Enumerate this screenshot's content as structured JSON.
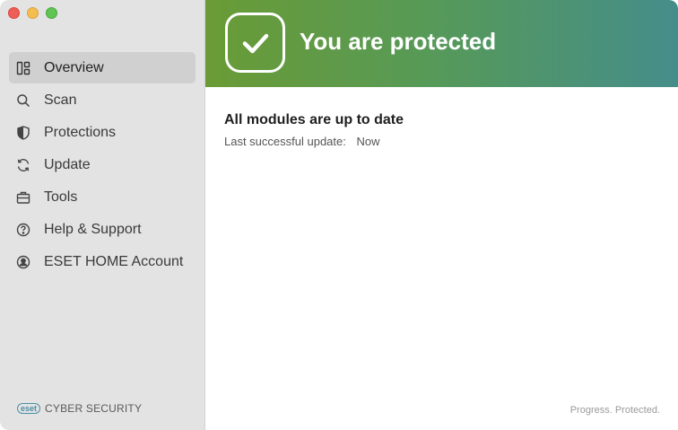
{
  "window": {
    "traffic_lights": [
      "close",
      "minimize",
      "maximize"
    ]
  },
  "sidebar": {
    "items": [
      {
        "label": "Overview",
        "icon": "dashboard-icon",
        "active": true
      },
      {
        "label": "Scan",
        "icon": "search-icon"
      },
      {
        "label": "Protections",
        "icon": "shield-icon"
      },
      {
        "label": "Update",
        "icon": "refresh-icon"
      },
      {
        "label": "Tools",
        "icon": "briefcase-icon"
      },
      {
        "label": "Help & Support",
        "icon": "help-icon"
      },
      {
        "label": "ESET HOME Account",
        "icon": "account-icon"
      }
    ],
    "brand_logo": "eset",
    "brand_text": "CYBER SECURITY"
  },
  "hero": {
    "title": "You are protected",
    "icon": "checkmark-icon"
  },
  "status": {
    "title": "All modules are up to date",
    "update_label": "Last successful update:",
    "update_value": "Now"
  },
  "footer": {
    "tagline": "Progress. Protected."
  },
  "colors": {
    "sidebar_bg": "#e3e3e3",
    "active_item_bg": "#d0d0d0",
    "hero_gradient_start": "#6a9b35",
    "hero_gradient_end": "#458d8a",
    "brand_accent": "#4b8fa6"
  }
}
